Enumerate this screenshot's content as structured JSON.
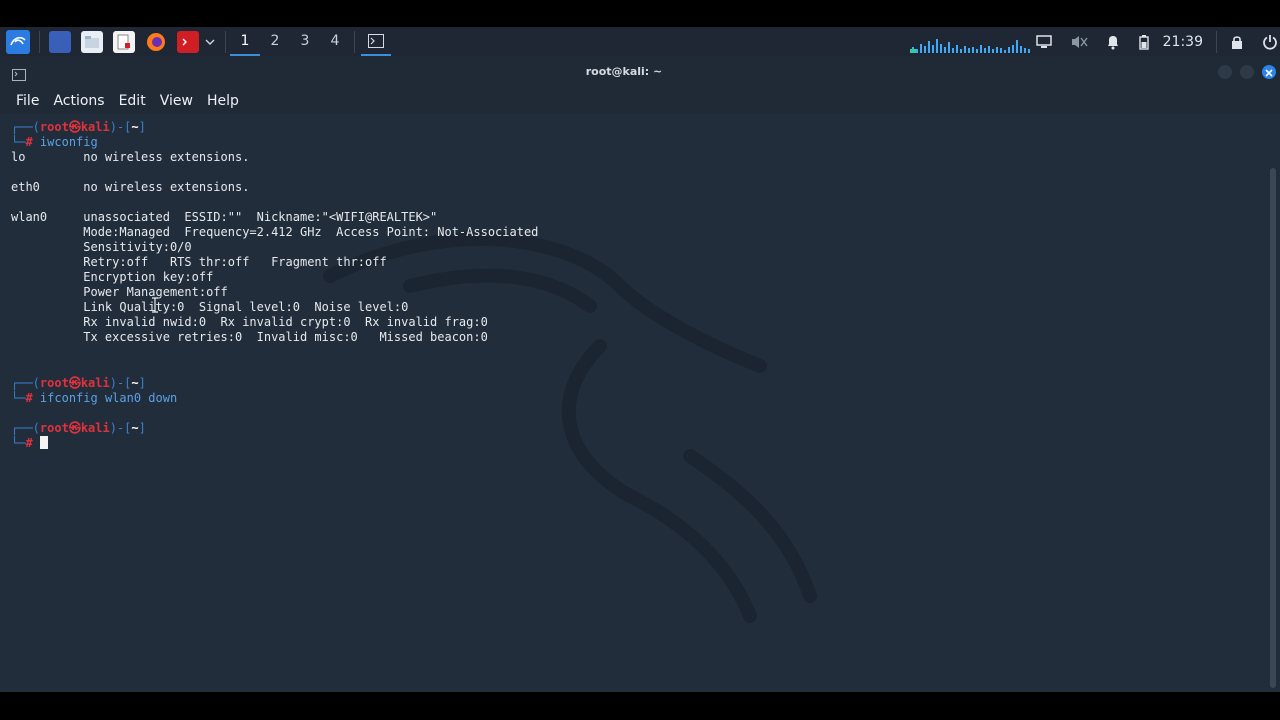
{
  "taskbar": {
    "workspaces": [
      "1",
      "2",
      "3",
      "4"
    ],
    "active_workspace": "1",
    "clock": "21:39",
    "icons": [
      "kali-menu-icon",
      "desktop-icon",
      "file-manager-icon",
      "text-editor-icon",
      "firefox-icon",
      "terminal-launcher-icon",
      "dropdown-icon"
    ],
    "tray_icons": [
      "display-icon",
      "mute-icon",
      "notification-bell-icon",
      "battery-icon",
      "lock-icon",
      "power-icon"
    ]
  },
  "window": {
    "title": "root@kali: ~",
    "menu": [
      "File",
      "Actions",
      "Edit",
      "View",
      "Help"
    ]
  },
  "terminal": {
    "prompt": {
      "top_prefix": "┌──(",
      "user": "root",
      "at": "㉿",
      "host": "kali",
      "mid": ")-[",
      "dir": "~",
      "end": "]",
      "bottom_prefix": "└─",
      "hash": "#"
    },
    "commands": [
      "iwconfig",
      "ifconfig wlan0 down"
    ],
    "output": [
      "lo        no wireless extensions.",
      "",
      "eth0      no wireless extensions.",
      "",
      "wlan0     unassociated  ESSID:\"\"  Nickname:\"<WIFI@REALTEK>\"",
      "          Mode:Managed  Frequency=2.412 GHz  Access Point: Not-Associated",
      "          Sensitivity:0/0",
      "          Retry:off   RTS thr:off   Fragment thr:off",
      "          Encryption key:off",
      "          Power Management:off",
      "          Link Quality:0  Signal level:0  Noise level:0",
      "          Rx invalid nwid:0  Rx invalid crypt:0  Rx invalid frag:0",
      "          Tx excessive retries:0  Invalid misc:0   Missed beacon:0"
    ]
  },
  "colors": {
    "terminal_bg": "#222d3b",
    "prompt_blue": "#3b7fd0",
    "root_red": "#e0323e",
    "taskbar_bg": "#1e2733",
    "accent": "#3b8fd9"
  }
}
